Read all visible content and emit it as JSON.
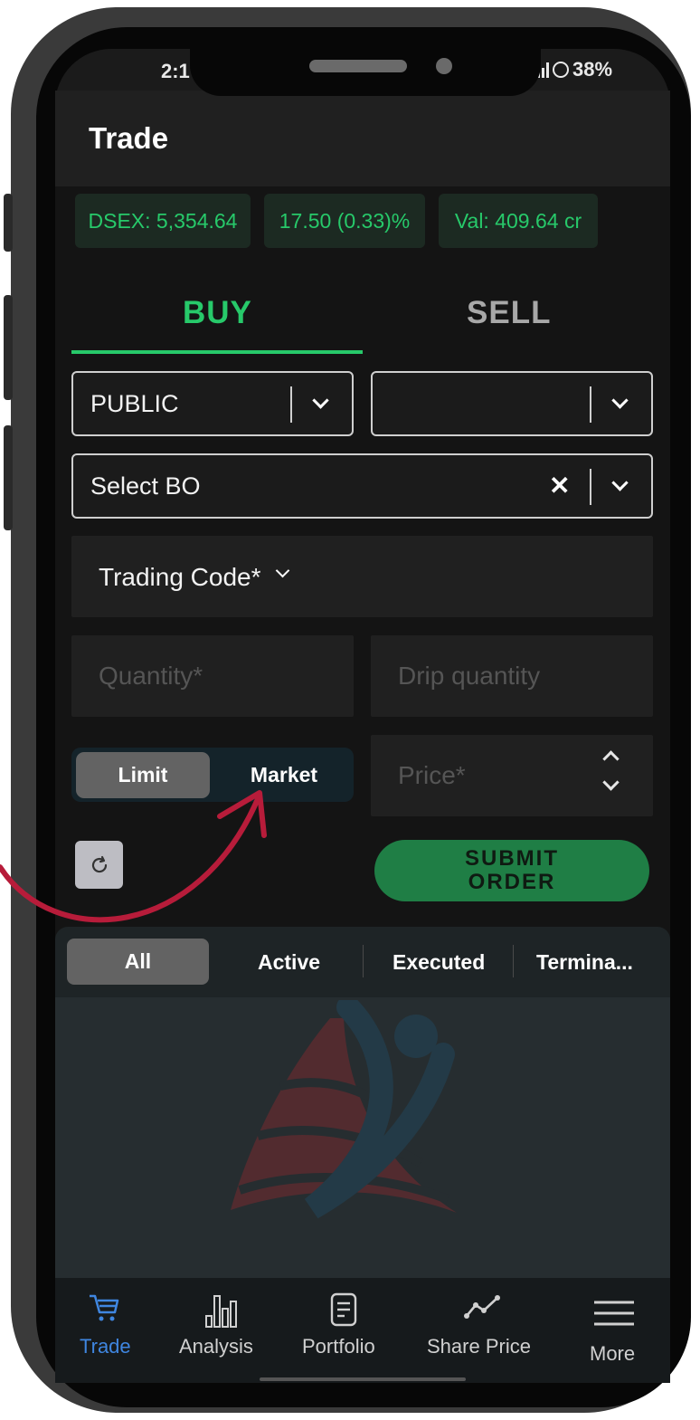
{
  "status_bar": {
    "time": "2:1",
    "battery": "38%"
  },
  "header": {
    "title": "Trade"
  },
  "ticker": {
    "index": "DSEX: 5,354.64",
    "change": "17.50 (0.33)%",
    "value": "Val: 409.64 cr"
  },
  "order_tabs": {
    "buy": "BUY",
    "sell": "SELL",
    "active": "BUY"
  },
  "form": {
    "market_select": "PUBLIC",
    "second_select": "",
    "bo_select": "Select BO",
    "trading_code": "Trading Code*",
    "quantity_placeholder": "Quantity*",
    "drip_placeholder": "Drip quantity",
    "order_type": {
      "limit": "Limit",
      "market": "Market",
      "selected": "Limit"
    },
    "price_placeholder": "Price*",
    "submit": "SUBMIT ORDER"
  },
  "order_filters": {
    "items": [
      "All",
      "Active",
      "Executed",
      "Termina..."
    ],
    "selected": "All"
  },
  "bottom_nav": {
    "items": [
      {
        "label": "Trade",
        "icon": "cart-icon",
        "active": true
      },
      {
        "label": "Analysis",
        "icon": "bar-chart-icon"
      },
      {
        "label": "Portfolio",
        "icon": "document-icon"
      },
      {
        "label": "Share Price",
        "icon": "line-chart-icon"
      },
      {
        "label": "More",
        "icon": "menu-icon"
      }
    ]
  },
  "colors": {
    "accent_green": "#27c96a",
    "submit_green": "#1f7e45",
    "active_nav_blue": "#3f86e0",
    "annotation_arrow": "#b71c3a"
  }
}
